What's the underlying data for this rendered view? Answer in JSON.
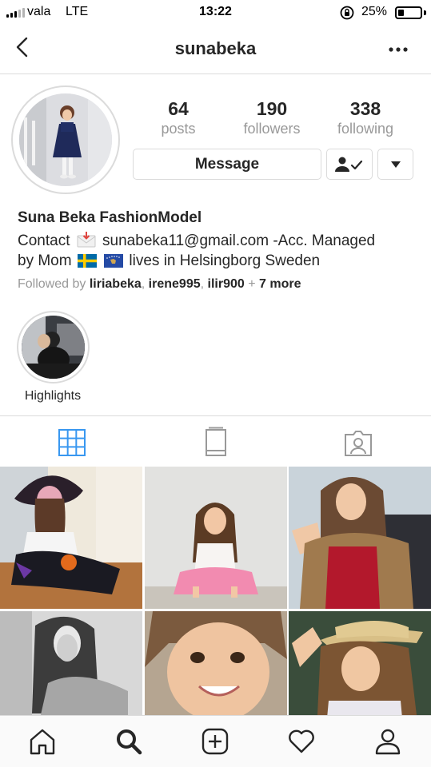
{
  "status_bar": {
    "carrier": "vala",
    "network": "LTE",
    "time": "13:22",
    "battery_percent": "25%",
    "battery_level": 0.25
  },
  "nav": {
    "username": "sunabeka",
    "back_icon": "back-chevron-icon",
    "more_icon": "more-dots-icon"
  },
  "profile": {
    "stats": [
      {
        "value": "64",
        "label": "posts"
      },
      {
        "value": "190",
        "label": "followers"
      },
      {
        "value": "338",
        "label": "following"
      }
    ],
    "message_label": "Message",
    "following_icon": "person-check-icon",
    "dropdown_icon": "caret-down-icon"
  },
  "bio": {
    "name": "Suna Beka FashionModel",
    "line1_prefix": "Contact",
    "line1_suffix": "sunabeka11@gmail.com -Acc. Managed",
    "line2_prefix": "by Mom",
    "line2_suffix": "lives in Helsingborg Sweden",
    "followed_by_prefix": "Followed by",
    "followers": [
      "liriabeka",
      "irene995",
      "ilir900"
    ],
    "separator": ",",
    "plus": "+",
    "more": "7 more"
  },
  "highlights": [
    {
      "label": "Highlights"
    }
  ],
  "tabs": [
    {
      "icon": "grid-icon",
      "active": true
    },
    {
      "icon": "feed-list-icon",
      "active": false
    },
    {
      "icon": "tagged-icon",
      "active": false
    }
  ],
  "bottom_nav": [
    {
      "icon": "home-icon"
    },
    {
      "icon": "search-icon",
      "active": true
    },
    {
      "icon": "add-post-icon"
    },
    {
      "icon": "heart-icon"
    },
    {
      "icon": "profile-icon"
    }
  ],
  "colors": {
    "accent_blue": "#3897f0",
    "text": "#262626",
    "muted": "#999999",
    "border": "#dbdbdb",
    "sweden_blue": "#006aa7",
    "sweden_yellow": "#fecc00",
    "kosovo_blue": "#244aa5",
    "kosovo_gold": "#d0a650"
  }
}
